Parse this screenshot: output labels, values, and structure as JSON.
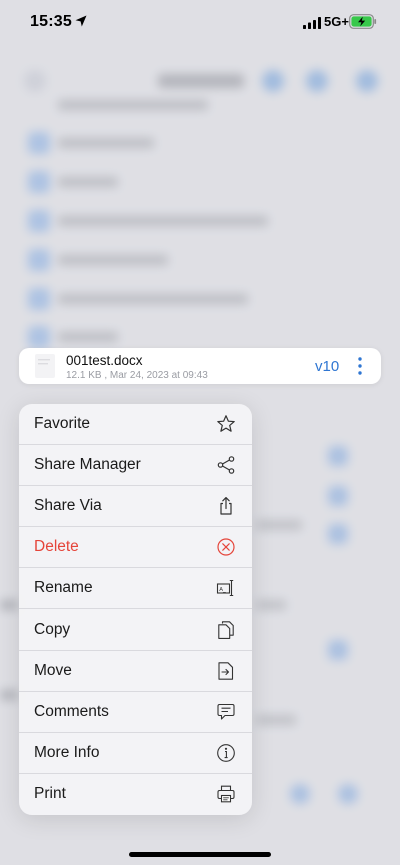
{
  "status_bar": {
    "time": "15:35",
    "network": "5G+"
  },
  "file": {
    "name": "001test.docx",
    "meta": "12.1 KB , Mar 24, 2023 at 09:43",
    "version": "v10"
  },
  "menu": {
    "items": [
      {
        "label": "Favorite",
        "icon": "star-icon"
      },
      {
        "label": "Share Manager",
        "icon": "share-nodes-icon"
      },
      {
        "label": "Share Via",
        "icon": "share-icon"
      },
      {
        "label": "Delete",
        "icon": "delete-circle-icon",
        "destructive": true
      },
      {
        "label": "Rename",
        "icon": "rename-icon"
      },
      {
        "label": "Copy",
        "icon": "copy-icon"
      },
      {
        "label": "Move",
        "icon": "move-icon"
      },
      {
        "label": "Comments",
        "icon": "comment-icon"
      },
      {
        "label": "More Info",
        "icon": "info-icon"
      },
      {
        "label": "Print",
        "icon": "print-icon"
      }
    ]
  },
  "colors": {
    "accent": "#2f76d2",
    "destructive": "#e5453a"
  }
}
